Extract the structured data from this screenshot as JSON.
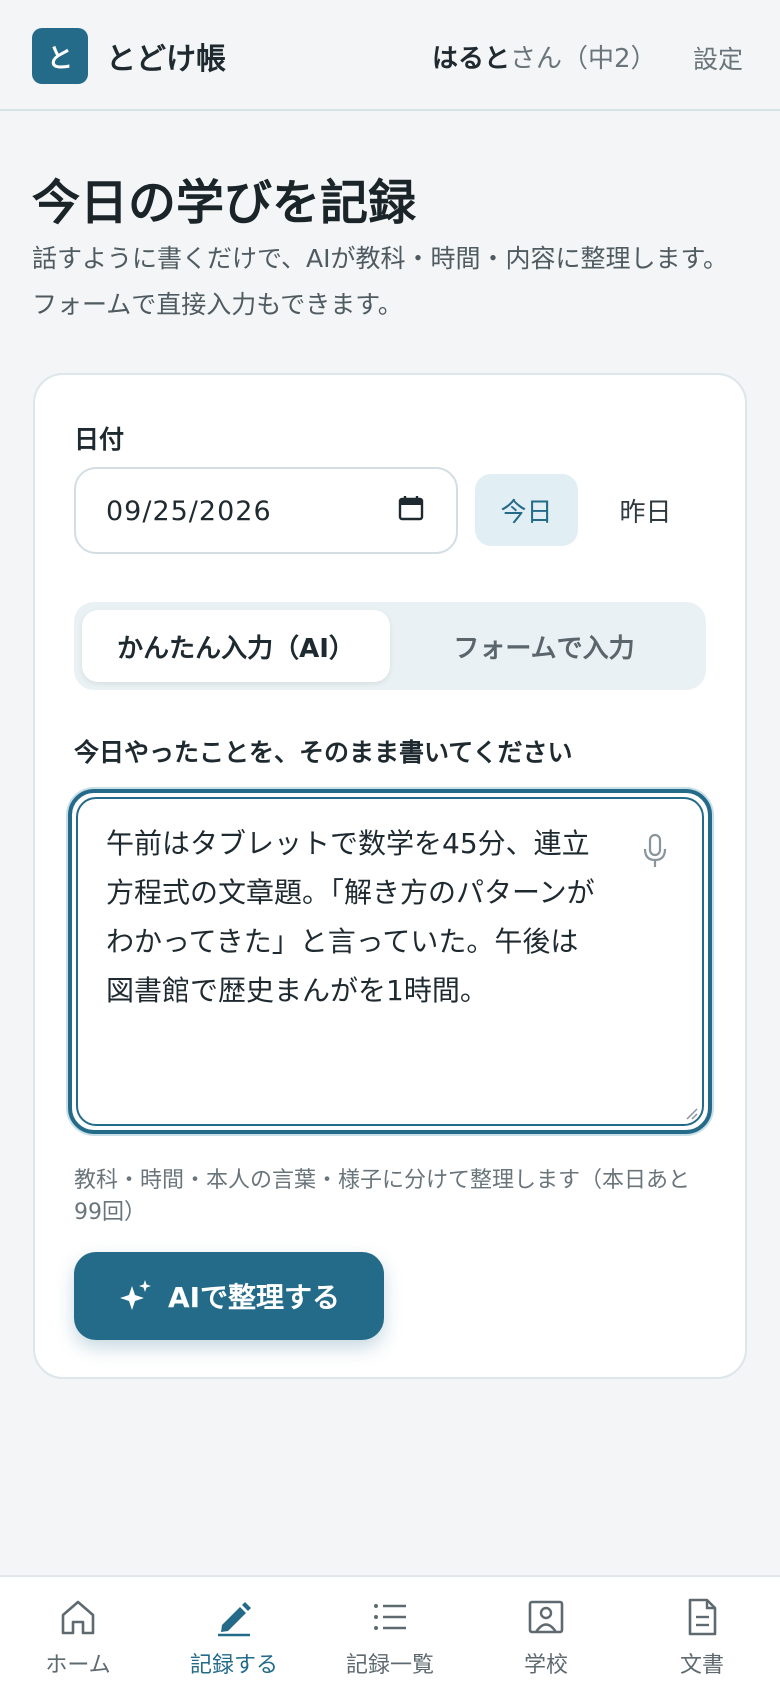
{
  "header": {
    "logo_char": "と",
    "app_name": "とどけ帳",
    "user_name": "はると",
    "user_suffix": "さん（中2）",
    "settings_label": "設定"
  },
  "page": {
    "title": "今日の学びを記録",
    "description": "話すように書くだけで、AIが教科・時間・内容に整理します。フォームで直接入力もできます。"
  },
  "form": {
    "date_label": "日付",
    "date_value": "09/25/2026",
    "today_label": "今日",
    "yesterday_label": "昨日",
    "tabs": [
      {
        "label": "かんたん入力（AI）",
        "active": true
      },
      {
        "label": "フォームで入力",
        "active": false
      }
    ],
    "input_label": "今日やったことを、そのまま書いてください",
    "input_text": "午前はタブレットで数学を45分、連立方程式の文章題。「解き方のパターンがわかってきた」と言っていた。午後は図書館で歴史まんがを1時間。",
    "helper_text": "教科・時間・本人の言葉・様子に分けて整理します（本日あと99回）",
    "ai_button_label": "AIで整理する"
  },
  "nav": {
    "items": [
      {
        "label": "ホーム",
        "icon": "home-icon"
      },
      {
        "label": "記録する",
        "icon": "pencil-icon",
        "active": true
      },
      {
        "label": "記録一覧",
        "icon": "list-icon"
      },
      {
        "label": "学校",
        "icon": "school-icon"
      },
      {
        "label": "文書",
        "icon": "document-icon"
      }
    ]
  },
  "colors": {
    "accent": "#246b8a",
    "background": "#f3f5f7",
    "card": "#ffffff"
  }
}
